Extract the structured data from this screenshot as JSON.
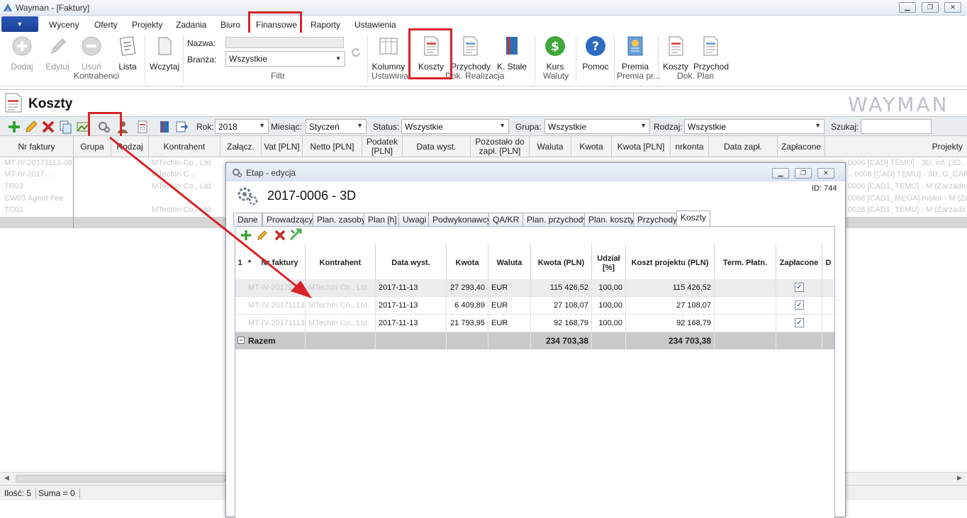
{
  "window": {
    "title": "Wayman - [Faktury]",
    "controls": [
      "minimize",
      "maximize",
      "close"
    ]
  },
  "menu": [
    "Wyceny",
    "Oferty",
    "Projekty",
    "Zadania",
    "Biuro",
    "Finansowe",
    "Raporty",
    "Ustawienia"
  ],
  "ribbon": {
    "buttons": {
      "add": "Dodaj",
      "edit": "Edytuj",
      "remove": "Usuń",
      "list": "Lista",
      "load": "Wczytaj",
      "columns": "Kolumny",
      "costs": "Koszty",
      "revenues": "Przychody",
      "fixed": "K. Stałe",
      "rate": "Kurs",
      "help": "Pomoc",
      "bonus": "Premia",
      "plan_costs": "Koszty",
      "plan_revenue": "Przychod"
    },
    "groups": {
      "contractors": "Kontrahenci",
      "filter": "Filtr",
      "settings": "Ustawinia",
      "realization": "Dok. Realizacja",
      "currencies": "Waluty",
      "bonus": "Premia pr...",
      "plan": "Dok. Plan"
    },
    "name_label": "Nazwa:",
    "branch_label": "Branża:",
    "branch_value": "Wszystkie"
  },
  "pane": {
    "title": "Koszty",
    "logo": "WAYMAN"
  },
  "filters": {
    "year_label": "Rok:",
    "year": "2018",
    "month_label": "Miesiąc:",
    "month": "Styczeń",
    "status_label": "Status:",
    "status": "Wszystkie",
    "group_label": "Grupa:",
    "group": "Wszystkie",
    "kind_label": "Rodzaj:",
    "kind": "Wszystkie",
    "search_label": "Szukaj:"
  },
  "grid_columns": [
    "Nr faktury",
    "Grupa",
    "Rodzaj",
    "Kontrahent",
    "Załącz.",
    "Vat [PLN]",
    "Netto [PLN]",
    "Podatek [PLN]",
    "Data wyst.",
    "Pozostało do zapł. [PLN]",
    "Waluta",
    "Kwota",
    "Kwota [PLN]",
    "nrkonta",
    "Data zapł.",
    "Zapłacone",
    "Projekty"
  ],
  "bg_rows": [
    {
      "nr": "MT-IV-20171113-08",
      "kontr": "MTechIn Co., Ltd.",
      "proj": "0006 [CAD] TEMU] - 3D, inf. (3D..."
    },
    {
      "nr": "MT-IV-2017...",
      "kontr": "MTechIn C...",
      "proj": "...0008 [CAD] TEMU] - 3D, O_CAP..."
    },
    {
      "nr": "TR03",
      "kontr": "MTechIn Co., Ltd.",
      "proj": "0006 [CAD1_TEMU] - M (Zarzadn..."
    },
    {
      "nr": "CW03 Agent Fee",
      "kontr": "",
      "proj": "0068 [CAD1_MEGA] motor - M (Zar..."
    },
    {
      "nr": "TC01",
      "kontr": "MTechIn Co., Ltd.",
      "proj": "0026 [CAD1_TEMU] - M (Zarzadz..."
    }
  ],
  "status": {
    "count": "Ilość: 5",
    "sum": "Suma = 0"
  },
  "dialog": {
    "title": "Etap - edycja",
    "heading": "2017-0006 - 3D",
    "id": "ID: 744",
    "tabs": [
      "Dane",
      "Prowadzący",
      "Plan. zasoby",
      "Plan [h]",
      "Uwagi",
      "Podwykonawcy",
      "QA/KR",
      "Plan. przychody",
      "Plan. koszty",
      "Przychody",
      "Koszty"
    ],
    "active_tab": "Koszty",
    "columns": [
      "1",
      "*",
      "Nr faktury",
      "Kontrahent",
      "Data wyst.",
      "Kwota",
      "Waluta",
      "Kwota (PLN)",
      "Udział [%]",
      "Koszt projektu (PLN)",
      "Term. Płatn.",
      "Zapłacone",
      "D"
    ],
    "rows": [
      {
        "nr": "MT-IV-20171113...",
        "kontrahent": "MTechIn Co., Ltd.",
        "data": "2017-11-13",
        "kwota": "27 293,40",
        "waluta": "EUR",
        "kwota_pln": "115 426,52",
        "udzial": "100,00",
        "koszt": "115 426,52",
        "zaplacone": true
      },
      {
        "nr": "MT-IV-20171113...",
        "kontrahent": "MTechIn Co., Ltd.",
        "data": "2017-11-13",
        "kwota": "6 409,89",
        "waluta": "EUR",
        "kwota_pln": "27 108,07",
        "udzial": "100,00",
        "koszt": "27 108,07",
        "zaplacone": true
      },
      {
        "nr": "MT-IV-20171113...",
        "kontrahent": "MTechIn Co., Ltd.",
        "data": "2017-11-13",
        "kwota": "21 793,95",
        "waluta": "EUR",
        "kwota_pln": "92 168,79",
        "udzial": "100,00",
        "koszt": "92 168,79",
        "zaplacone": true
      }
    ],
    "total_label": "Razem",
    "total_kwota_pln": "234 703,38",
    "total_koszt": "234 703,38"
  },
  "colors": {
    "highlight": "#d9232a",
    "app_menu": "#1f47a6",
    "sum_row": "#c9c9c9"
  }
}
